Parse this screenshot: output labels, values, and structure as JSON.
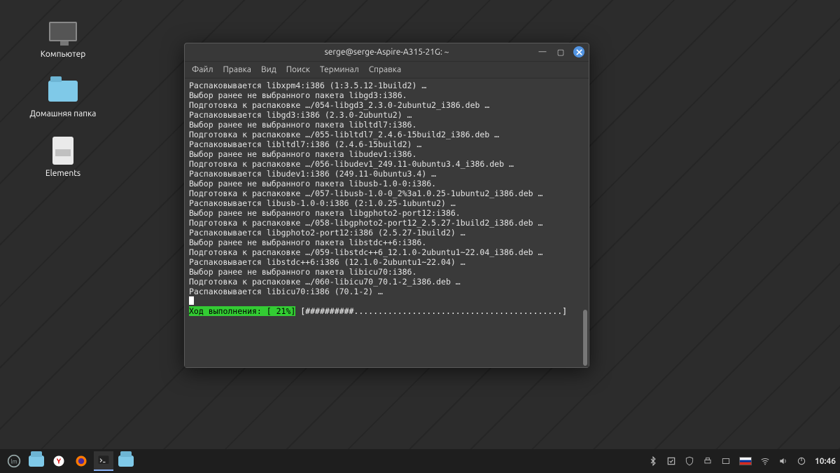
{
  "desktop": {
    "icons": [
      {
        "label": "Компьютер"
      },
      {
        "label": "Домашняя папка"
      },
      {
        "label": "Elements"
      }
    ]
  },
  "terminal": {
    "title": "serge@serge-Aspire-A315-21G: ~",
    "menu": [
      "Файл",
      "Правка",
      "Вид",
      "Поиск",
      "Терминал",
      "Справка"
    ],
    "lines": [
      "Распаковывается libxpm4:i386 (1:3.5.12-1build2) …",
      "Выбор ранее не выбранного пакета libgd3:i386.",
      "Подготовка к распаковке …/054-libgd3_2.3.0-2ubuntu2_i386.deb …",
      "Распаковывается libgd3:i386 (2.3.0-2ubuntu2) …",
      "Выбор ранее не выбранного пакета libltdl7:i386.",
      "Подготовка к распаковке …/055-libltdl7_2.4.6-15build2_i386.deb …",
      "Распаковывается libltdl7:i386 (2.4.6-15build2) …",
      "Выбор ранее не выбранного пакета libudev1:i386.",
      "Подготовка к распаковке …/056-libudev1_249.11-0ubuntu3.4_i386.deb …",
      "Распаковывается libudev1:i386 (249.11-0ubuntu3.4) …",
      "Выбор ранее не выбранного пакета libusb-1.0-0:i386.",
      "Подготовка к распаковке …/057-libusb-1.0-0_2%3a1.0.25-1ubuntu2_i386.deb …",
      "Распаковывается libusb-1.0-0:i386 (2:1.0.25-1ubuntu2) …",
      "Выбор ранее не выбранного пакета libgphoto2-port12:i386.",
      "Подготовка к распаковке …/058-libgphoto2-port12_2.5.27-1build2_i386.deb …",
      "Распаковывается libgphoto2-port12:i386 (2.5.27-1build2) …",
      "Выбор ранее не выбранного пакета libstdc++6:i386.",
      "Подготовка к распаковке …/059-libstdc++6_12.1.0-2ubuntu1~22.04_i386.deb …",
      "Распаковывается libstdc++6:i386 (12.1.0-2ubuntu1~22.04) …",
      "Выбор ранее не выбранного пакета libicu70:i386.",
      "Подготовка к распаковке …/060-libicu70_70.1-2_i386.deb …",
      "Распаковывается libicu70:i386 (70.1-2) …"
    ],
    "progress": {
      "label": "Ход выполнения: [ 21%]",
      "bar": " [##########...........................................]"
    }
  },
  "taskbar": {
    "clock": "10:46"
  }
}
